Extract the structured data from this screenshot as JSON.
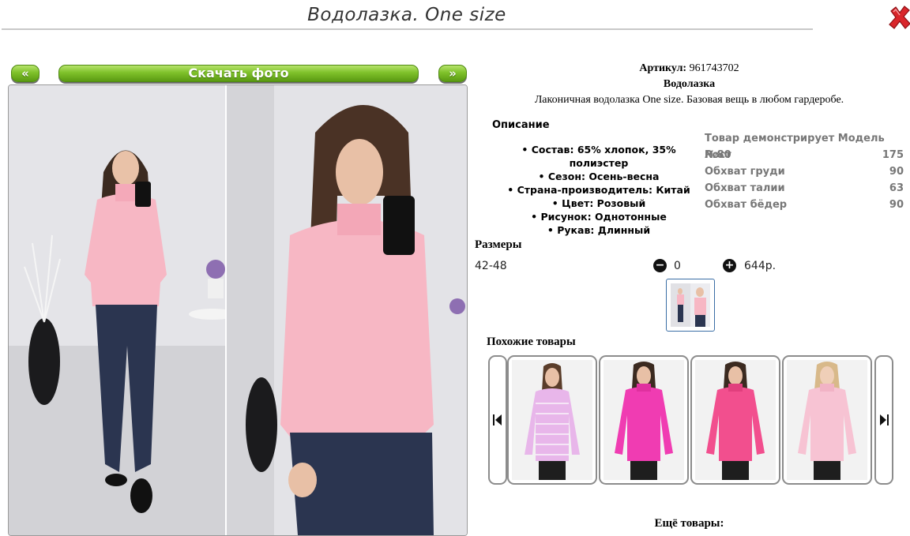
{
  "header": {
    "title": "Водолазка. One size"
  },
  "nav": {
    "prev_label": "«",
    "next_label": "»",
    "download_label": "Скачать фото"
  },
  "product": {
    "article_label": "Артикул:",
    "article_value": "961743702",
    "name": "Водолазка",
    "description": "Лаконичная водолазка One size. Базовая вещь в любом гардеробе."
  },
  "specs": {
    "heading": "Описание",
    "items": [
      "Состав: 65% хлопок, 35% полиэстер",
      "Сезон: Осень-весна",
      "Страна-производитель: Китай",
      "Цвет: Розовый",
      "Рисунок: Однотонные",
      "Рукав: Длинный"
    ]
  },
  "model": {
    "heading": "Товар демонстрирует Модель №80",
    "rows": [
      {
        "label": "Рост",
        "value": "175"
      },
      {
        "label": "Обхват груди",
        "value": "90"
      },
      {
        "label": "Обхват талии",
        "value": "63"
      },
      {
        "label": "Обхват бёдер",
        "value": "90"
      }
    ]
  },
  "sizes": {
    "heading": "Размеры",
    "range": "42-48",
    "quantity": "0",
    "price": "644р.",
    "minus_icon": "minus-circle-icon",
    "plus_icon": "plus-circle-icon"
  },
  "similar": {
    "heading": "Похожие товары"
  },
  "more": {
    "heading": "Ещё товары:"
  },
  "colors": {
    "green_button": "#7fc12a",
    "close_red": "#d9262b",
    "sweater_pink": "#f7b7c4",
    "magenta": "#f03cb2",
    "hot_pink": "#f24f8e",
    "lilac": "#e8b6ea",
    "jeans": "#2b3550"
  }
}
